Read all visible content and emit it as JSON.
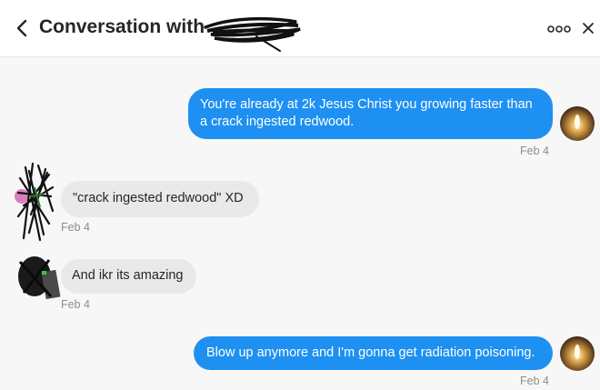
{
  "header": {
    "title": "Conversation with",
    "back_icon": "chevron-left-icon",
    "more_icon": "more-options-icon",
    "close_icon": "close-icon"
  },
  "messages": [
    {
      "direction": "sent",
      "text": "You're already at 2k Jesus Christ you growing faster than a crack ingested redwood.",
      "timestamp": "Feb 4"
    },
    {
      "direction": "received",
      "text": "\"crack ingested redwood\" XD",
      "timestamp": "Feb 4"
    },
    {
      "direction": "received",
      "text": "And ikr its amazing",
      "timestamp": "Feb 4"
    },
    {
      "direction": "sent",
      "text": "Blow up anymore and I'm gonna get radiation poisoning.",
      "timestamp": "Feb 4"
    }
  ],
  "colors": {
    "sent_bubble": "#1e90f1",
    "received_bubble": "#e9e9e9",
    "timestamp": "#8e8e8e",
    "background": "#f7f7f7"
  }
}
